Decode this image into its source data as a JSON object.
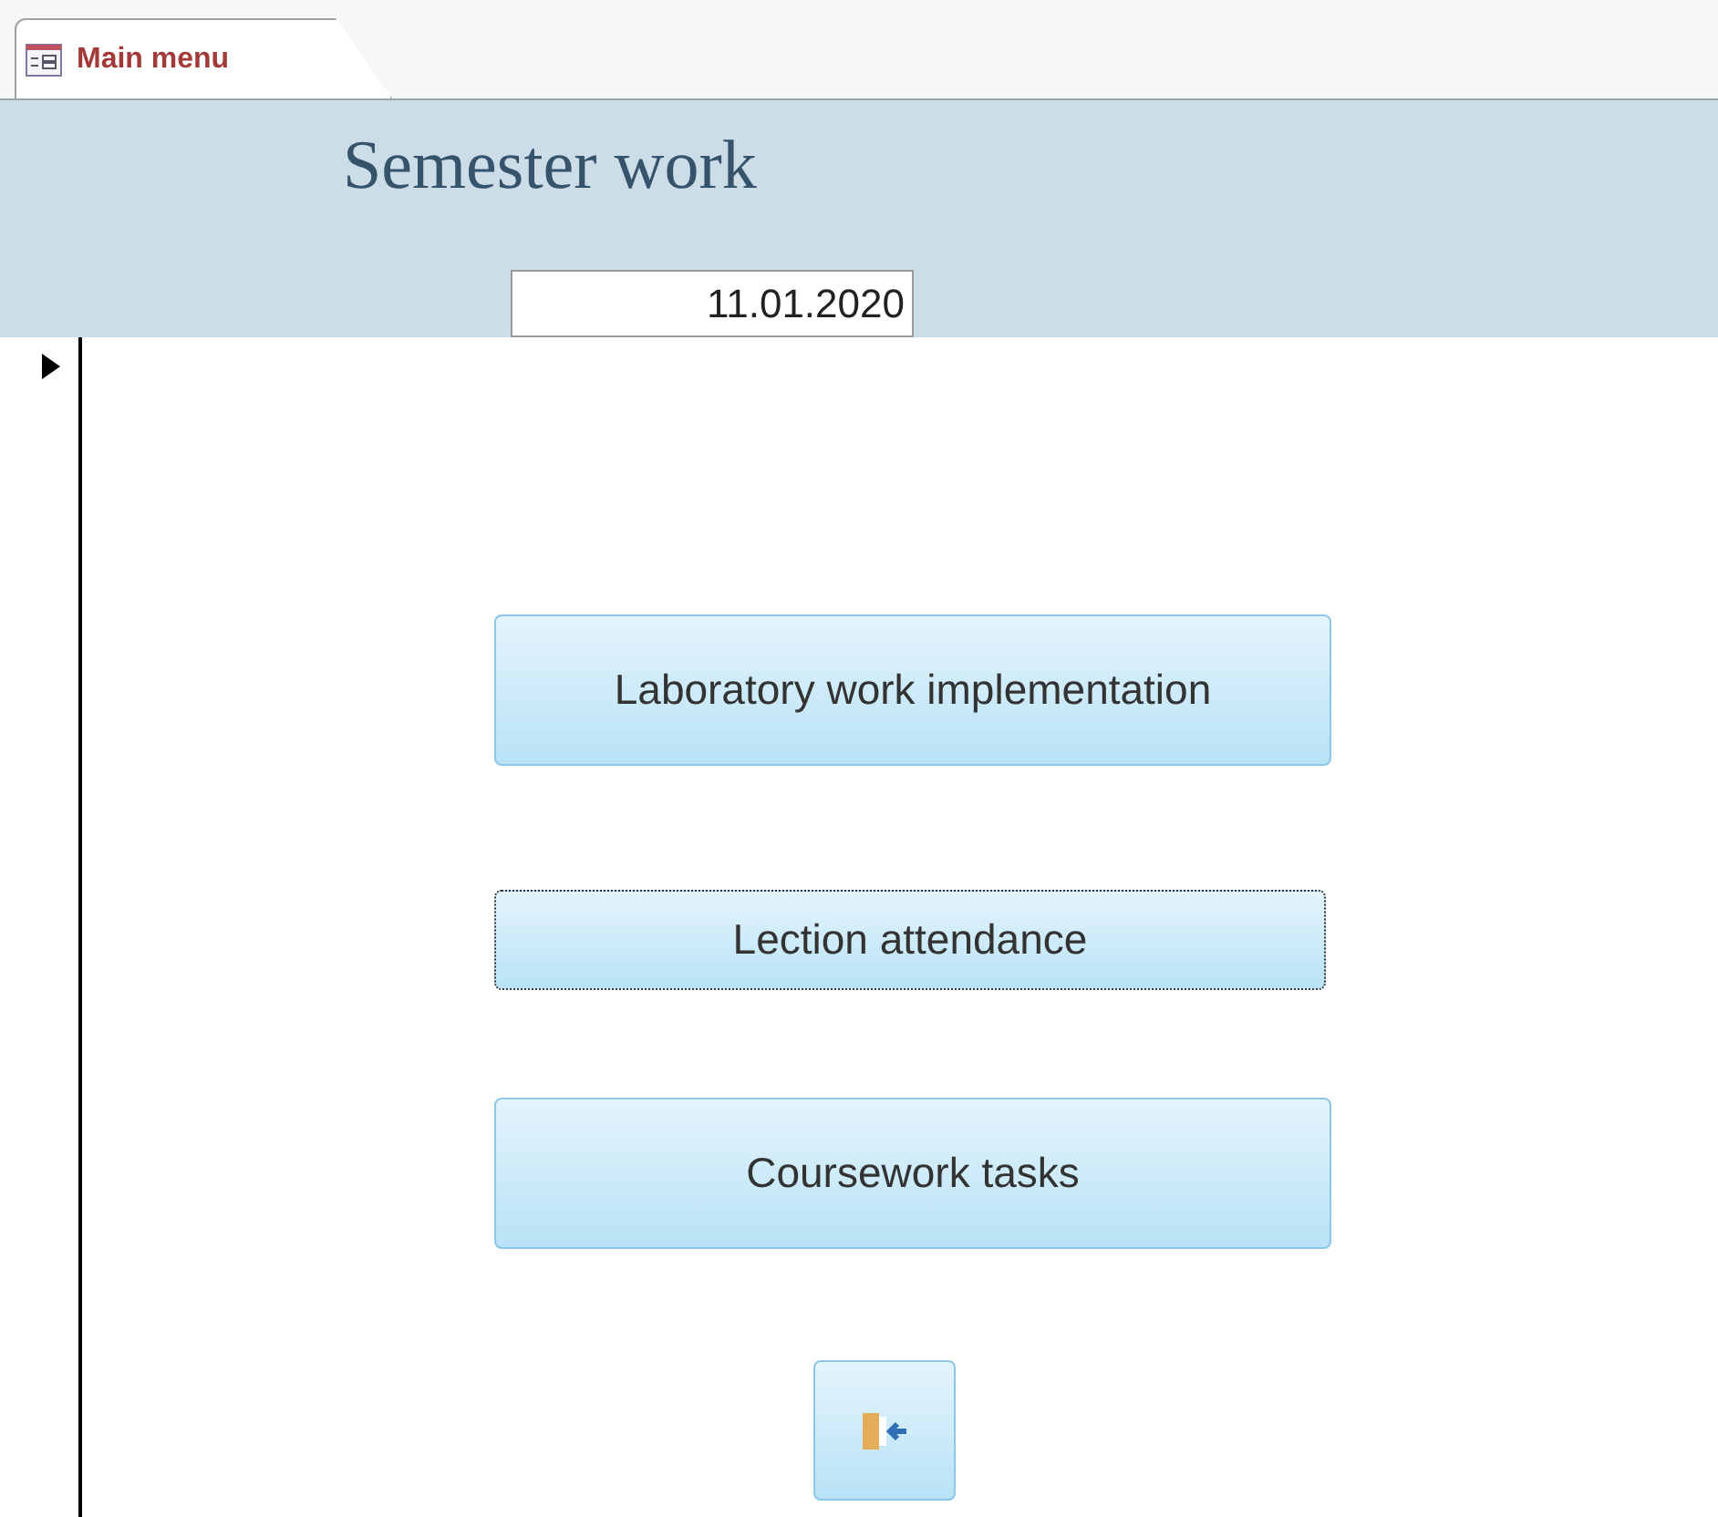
{
  "tab": {
    "label": "Main menu",
    "selected": true
  },
  "header": {
    "title": "Semester work",
    "date": "11.01.2020"
  },
  "buttons": [
    {
      "label": "Laboratory work implementation",
      "focused": false,
      "kind": "large"
    },
    {
      "label": "Lection attendance",
      "focused": true,
      "kind": "small"
    },
    {
      "label": "Coursework tasks",
      "focused": false,
      "kind": "large"
    }
  ],
  "exit_button": {
    "focused": false
  }
}
